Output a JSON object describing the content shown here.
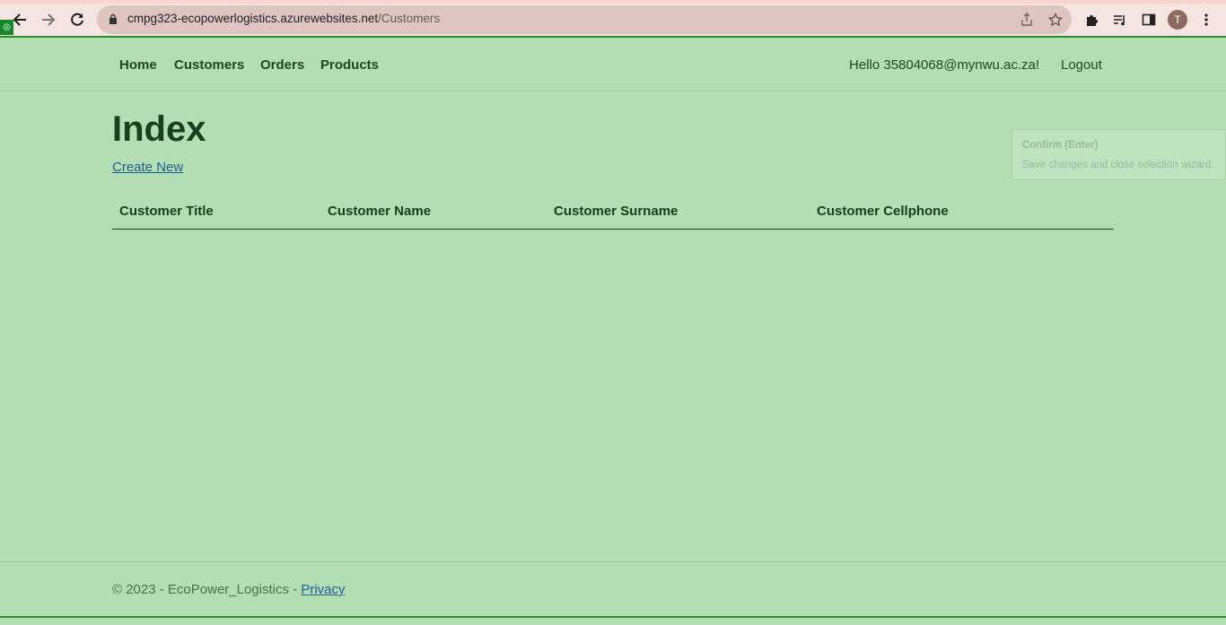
{
  "browser": {
    "url_host": "cmpg323-ecopowerlogistics.azurewebsites.net",
    "url_path": "/Customers",
    "profile_initial": "T",
    "icons": [
      "back-icon",
      "forward-icon",
      "reload-icon",
      "lock-icon",
      "share-icon",
      "star-icon",
      "extensions-icon",
      "reading-list-icon",
      "side-panel-icon",
      "menu-icon"
    ]
  },
  "navbar": {
    "links": [
      "Home",
      "Customers",
      "Orders",
      "Products"
    ],
    "hello": "Hello 35804068@mynwu.ac.za!",
    "logout": "Logout"
  },
  "main": {
    "title": "Index",
    "create_new": "Create New",
    "table": {
      "columns": [
        "Customer Title",
        "Customer Name",
        "Customer Surname",
        "Customer Cellphone"
      ],
      "rows": []
    }
  },
  "tooltip": {
    "title": "Confirm (Enter)",
    "body": "Save changes and close selection wizard."
  },
  "footer": {
    "text": "© 2023 - EcoPower_Logistics - ",
    "privacy": "Privacy"
  },
  "colors": {
    "page_bg": "#b3ddb3",
    "heading": "#17401e",
    "link": "#1f5f96",
    "accent_line": "#2f8f2f"
  }
}
